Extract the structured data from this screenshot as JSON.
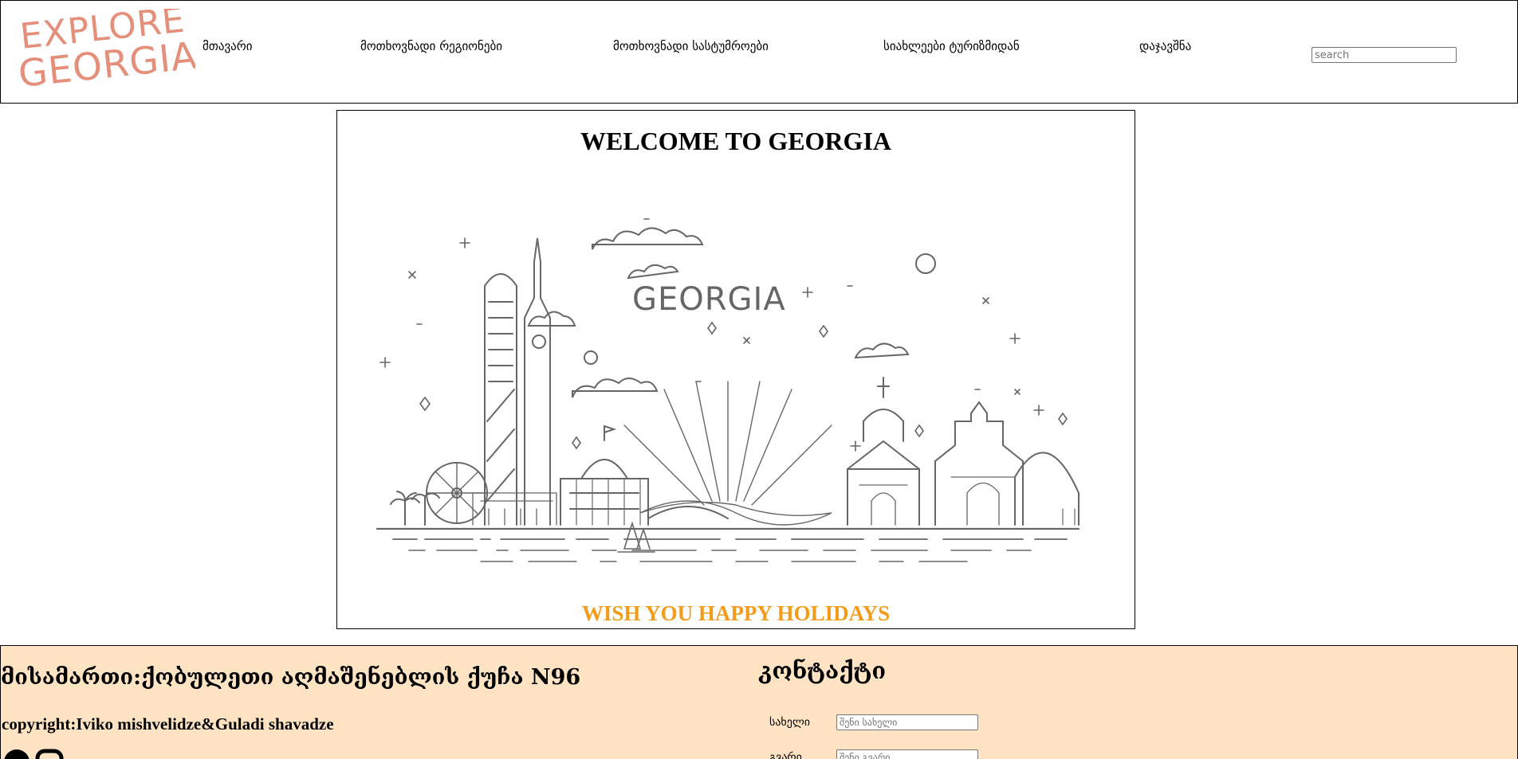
{
  "header": {
    "logo": {
      "line1": "EXPLORE",
      "line2": "GEORGIA",
      "color": "#e58e7a"
    },
    "nav": [
      "მთავარი",
      "მოთხოვნადი რეგიონები",
      "მოთხოვნადი სასტუმროები",
      "სიახლეები ტურიზმიდან",
      "დაჯავშნა"
    ],
    "search_placeholder": "search"
  },
  "hero": {
    "title": "WELCOME TO GEORGIA",
    "illustration_text": "GEORGIA",
    "tagline": "WISH YOU HAPPY HOLIDAYS",
    "tagline_color": "#f39c1b"
  },
  "footer": {
    "background": "#ffe3c2",
    "address": "მისამართი:ქობულეთი აღმაშენებლის ქუჩა N96",
    "copyright": "copyright:Iviko mishvelidze&Guladi shavadze",
    "contact": {
      "title": "კონტაქტი",
      "name_label": "სახელი",
      "name_placeholder": "შენი სახელი",
      "surname_label": "გვარი",
      "surname_placeholder": "შენი გვარი"
    },
    "social_icons": [
      "pinterest-icon",
      "instagram-icon"
    ]
  }
}
